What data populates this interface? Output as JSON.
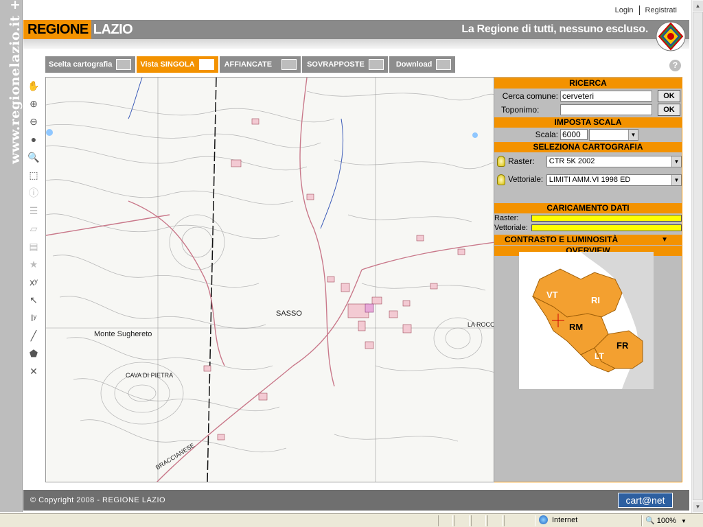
{
  "site": {
    "side_brand": "www.regionelazio.it +",
    "logo_word1": "REGIONE",
    "logo_word2": "LAZIO",
    "slogan": "La Regione di tutti, nessuno escluso."
  },
  "top_links": {
    "login": "Login",
    "register": "Registrati"
  },
  "tabs": [
    {
      "label": "Scelta cartografia",
      "active": false
    },
    {
      "label": "Vista SINGOLA",
      "active": true
    },
    {
      "label": "AFFIANCATE",
      "active": false
    },
    {
      "label": "SOVRAPPOSTE",
      "active": false
    },
    {
      "label": "Download",
      "active": false
    }
  ],
  "help_label": "?",
  "tools": [
    {
      "name": "pan-hand-icon",
      "glyph": "✋",
      "enabled": true
    },
    {
      "name": "zoom-in-icon",
      "glyph": "⊕",
      "enabled": true
    },
    {
      "name": "zoom-out-icon",
      "glyph": "⊖",
      "enabled": true
    },
    {
      "name": "globe-icon",
      "glyph": "●",
      "enabled": true
    },
    {
      "name": "zoom-search-icon",
      "glyph": "🔍",
      "enabled": true
    },
    {
      "name": "zoom-box-icon",
      "glyph": "⬚",
      "enabled": true
    },
    {
      "name": "info-icon",
      "glyph": "ⓘ",
      "enabled": false
    },
    {
      "name": "list-icon",
      "glyph": "☰",
      "enabled": false
    },
    {
      "name": "layer-icon",
      "glyph": "▱",
      "enabled": false
    },
    {
      "name": "print-icon",
      "glyph": "▤",
      "enabled": false
    },
    {
      "name": "bookmark-icon",
      "glyph": "★",
      "enabled": false
    },
    {
      "name": "xy-coord-icon",
      "glyph": "xʸ",
      "enabled": true
    },
    {
      "name": "xy-pointer-icon",
      "glyph": "↖",
      "enabled": true
    },
    {
      "name": "xy-input-icon",
      "glyph": "Iʸ",
      "enabled": true
    },
    {
      "name": "measure-line-icon",
      "glyph": "╱",
      "enabled": true
    },
    {
      "name": "measure-area-icon",
      "glyph": "⬟",
      "enabled": true
    },
    {
      "name": "clear-icon",
      "glyph": "✕",
      "enabled": true
    }
  ],
  "map_labels": [
    {
      "text": "SASSO",
      "pos": "a"
    },
    {
      "text": "Monte Sughereto",
      "pos": "b"
    },
    {
      "text": "CAVA DI PIETRA",
      "pos": "c"
    },
    {
      "text": "LA ROCCA",
      "pos": "d"
    },
    {
      "text": "BRACCIANESE",
      "pos": "e"
    }
  ],
  "panel": {
    "ricerca_title": "RICERCA",
    "cerca_comune_label": "Cerca comune:",
    "cerca_comune_value": "cerveteri",
    "toponimo_label": "Toponimo:",
    "toponimo_value": "",
    "ok_label": "OK",
    "scala_title": "IMPOSTA SCALA",
    "scala_label": "Scala:",
    "scala_value": "6000",
    "carto_title": "SELEZIONA CARTOGRAFIA",
    "raster_label": "Raster:",
    "raster_value": "CTR  5K 2002",
    "vettoriale_label": "Vettoriale:",
    "vettoriale_value": "LIMITI AMM.VI 1998 ED",
    "caricamento_title": "CARICAMENTO DATI",
    "load_raster_label": "Raster:",
    "load_vettoriale_label": "Vettoriale:",
    "contrasto_title": "CONTRASTO E LUMINOSITÀ",
    "overview_title": "OVERVIEW",
    "provinces": [
      "VT",
      "RI",
      "RM",
      "FR",
      "LT"
    ]
  },
  "footer": {
    "copyright": "© Copyright 2008 - REGIONE LAZIO",
    "cartanet": "cart@net"
  },
  "statusbar": {
    "zone": "Internet",
    "zoom": "100%"
  },
  "colors": {
    "accent": "#f39200",
    "header_gray": "#8a8a8a",
    "panel_gray": "#bdbdbd",
    "load_bar": "#ffff00"
  }
}
